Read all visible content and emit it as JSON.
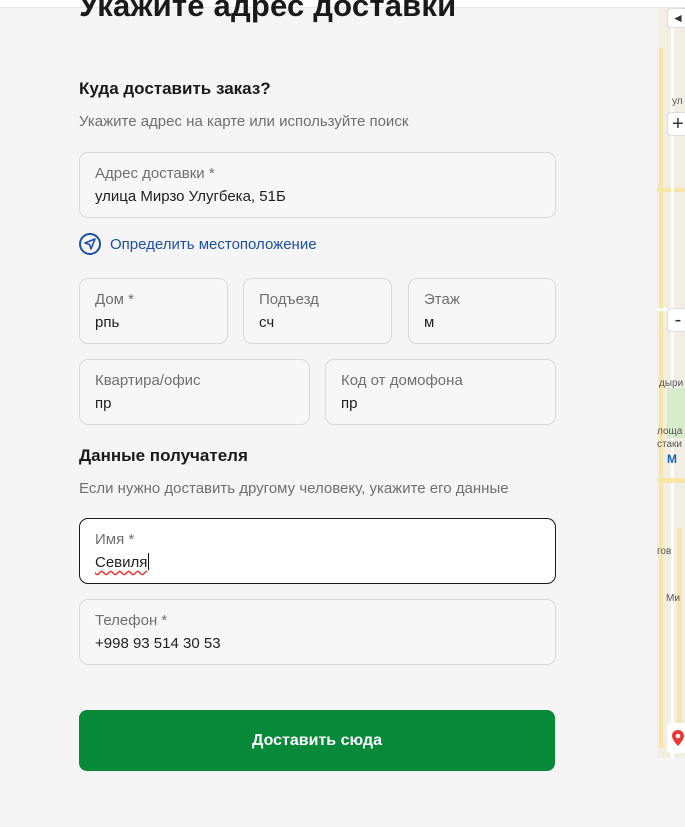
{
  "page": {
    "title": "Укажите адрес доставки"
  },
  "address_section": {
    "heading": "Куда доставить заказ?",
    "hint": "Укажите адрес на карте или используйте поиск",
    "address": {
      "label": "Адрес доставки *",
      "value": "улица Мирзо Улугбека, 51Б"
    },
    "locate_label": "Определить местоположение",
    "house": {
      "label": "Дом *",
      "value": "рпь"
    },
    "entrance": {
      "label": "Подъезд",
      "value": "сч"
    },
    "floor": {
      "label": "Этаж",
      "value": "м"
    },
    "apartment": {
      "label": "Квартира/офис",
      "value": "пр"
    },
    "intercom": {
      "label": "Код от домофона",
      "value": "пр"
    }
  },
  "recipient_section": {
    "heading": "Данные получателя",
    "hint": "Если нужно доставить другому человеку, укажите его данные",
    "name": {
      "label": "Имя *",
      "value": "Севиля"
    },
    "phone": {
      "label": "Телефон *",
      "value": "+998 93 514 30 53"
    }
  },
  "submit_label": "Доставить сюда",
  "map": {
    "zoom_in": "+",
    "zoom_out": "-",
    "labels": [
      "ул",
      "дыри",
      "лоща",
      "стаки",
      "гов",
      "Ми"
    ],
    "metro_marker": "M"
  },
  "colors": {
    "accent_green": "#07893a",
    "link_blue": "#1e4fa6",
    "background": "#f5f5f5"
  }
}
